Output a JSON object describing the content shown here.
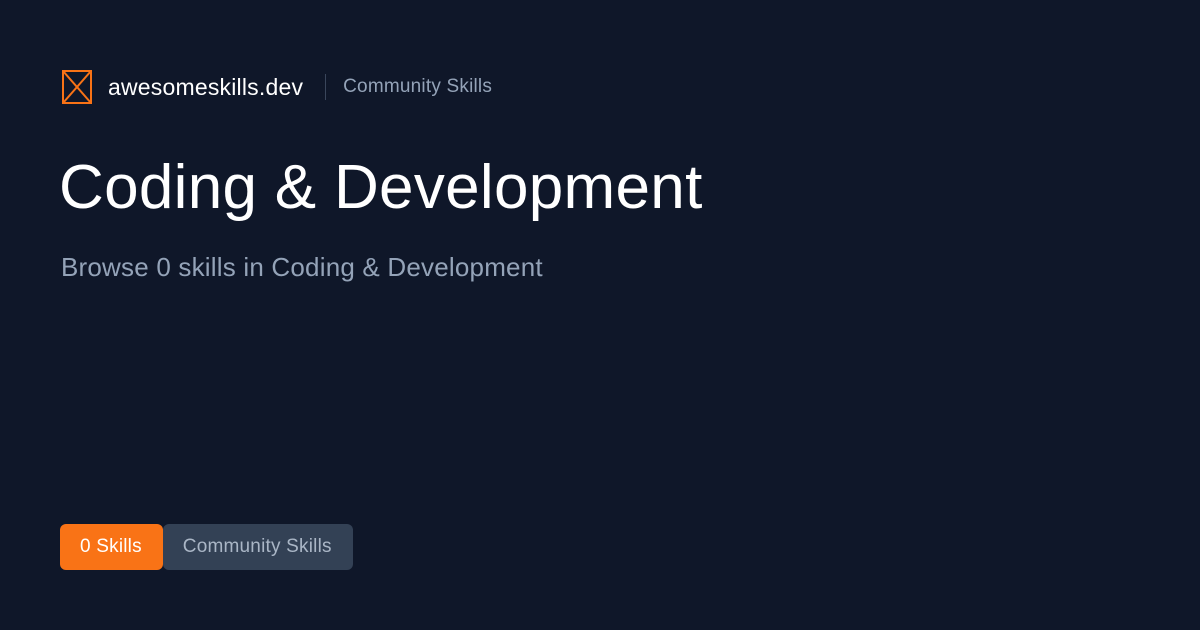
{
  "header": {
    "logo_icon": "box-x-icon",
    "site_name": "awesomeskills.dev",
    "tag": "Community Skills"
  },
  "main": {
    "title": "Coding & Development",
    "subtitle": "Browse 0 skills in Coding & Development"
  },
  "badges": {
    "count_label": "0 Skills",
    "tag_label": "Community Skills"
  },
  "colors": {
    "background": "#0f1729",
    "accent": "#f97316",
    "muted_text": "#94a3b8",
    "badge_secondary": "#334155"
  }
}
